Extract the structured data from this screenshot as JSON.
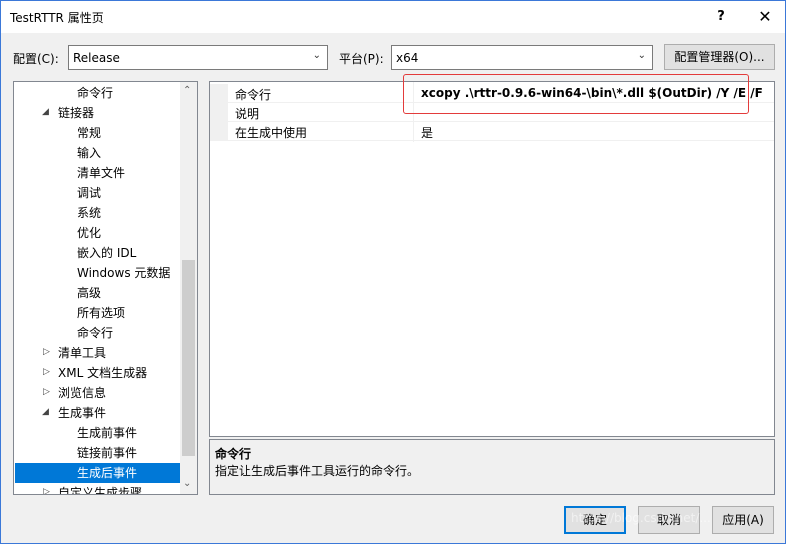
{
  "window": {
    "title": "TestRTTR 属性页",
    "help": "?",
    "close": "✕"
  },
  "toolbar": {
    "config_label": "配置(C):",
    "config_value": "Release",
    "platform_label": "平台(P):",
    "platform_value": "x64",
    "config_manager": "配置管理器(O)..."
  },
  "tree": {
    "items": [
      {
        "label": "命令行"
      },
      {
        "label": "链接器"
      },
      {
        "label": "常规"
      },
      {
        "label": "输入"
      },
      {
        "label": "清单文件"
      },
      {
        "label": "调试"
      },
      {
        "label": "系统"
      },
      {
        "label": "优化"
      },
      {
        "label": "嵌入的 IDL"
      },
      {
        "label": "Windows 元数据"
      },
      {
        "label": "高级"
      },
      {
        "label": "所有选项"
      },
      {
        "label": "命令行"
      },
      {
        "label": "清单工具"
      },
      {
        "label": "XML 文档生成器"
      },
      {
        "label": "浏览信息"
      },
      {
        "label": "生成事件"
      },
      {
        "label": "生成前事件"
      },
      {
        "label": "链接前事件"
      },
      {
        "label": "生成后事件"
      },
      {
        "label": "自定义生成步骤"
      }
    ]
  },
  "properties": [
    {
      "name": "命令行",
      "value": "xcopy .\\rttr-0.9.6-win64-\\bin\\*.dll $(OutDir) /Y /E /F"
    },
    {
      "name": "说明",
      "value": ""
    },
    {
      "name": "在生成中使用",
      "value": "是"
    }
  ],
  "description": {
    "title": "命令行",
    "text": "指定让生成后事件工具运行的命令行。"
  },
  "buttons": {
    "ok": "确定",
    "cancel": "取消",
    "apply": "应用(A)"
  },
  "watermark": "https://blog.csdn.net/...",
  "colors": {
    "selection": "#0078d7",
    "highlight_border": "#e33b3b"
  }
}
